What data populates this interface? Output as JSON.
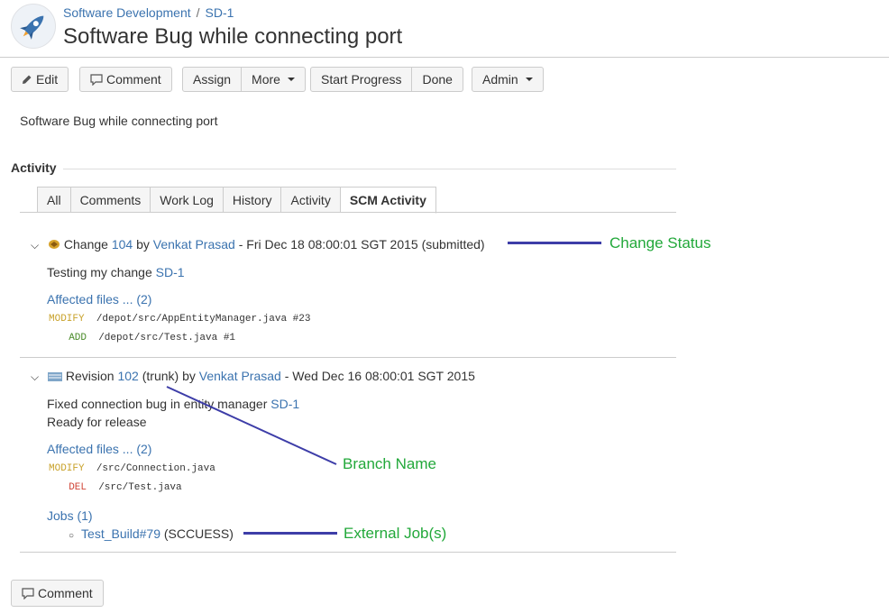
{
  "breadcrumb": {
    "project": "Software Development",
    "separator": "/",
    "issue_key": "SD-1"
  },
  "title": "Software Bug while connecting port",
  "toolbar": {
    "edit": "Edit",
    "comment": "Comment",
    "assign": "Assign",
    "more": "More",
    "start_progress": "Start Progress",
    "done": "Done",
    "admin": "Admin"
  },
  "description": "Software Bug while connecting port",
  "activity": {
    "heading": "Activity",
    "tabs": [
      "All",
      "Comments",
      "Work Log",
      "History",
      "Activity",
      "SCM Activity"
    ],
    "active_tab": "SCM Activity"
  },
  "changes": [
    {
      "kind": "Change",
      "id": "104",
      "by": "by",
      "author": "Venkat Prasad",
      "date": "- Fri Dec 18 08:00:01 SGT 2015",
      "status": "(submitted)",
      "message": "Testing my change",
      "message_link": "SD-1",
      "affected": "Affected files ... (2)",
      "files": [
        {
          "action": "MODIFY",
          "path": "/depot/src/AppEntityManager.java #23"
        },
        {
          "action": "ADD",
          "path": "/depot/src/Test.java #1"
        }
      ]
    },
    {
      "kind": "Revision",
      "id": "102",
      "branch": "(trunk)",
      "by": "by",
      "author": "Venkat Prasad",
      "date": "- Wed Dec 16 08:00:01 SGT 2015",
      "message": "Fixed connection bug in entity manager",
      "message_link": "SD-1",
      "message2": "Ready for release",
      "affected": "Affected files ... (2)",
      "files": [
        {
          "action": "MODIFY",
          "path": "/src/Connection.java"
        },
        {
          "action": "DEL",
          "path": "/src/Test.java"
        }
      ],
      "jobs_label": "Jobs (1)",
      "job_link": "Test_Build#79",
      "job_status": "(SCCUESS)"
    }
  ],
  "annotations": {
    "change_status": "Change Status",
    "branch_name": "Branch Name",
    "external_jobs": "External Job(s)"
  },
  "footer": {
    "comment": "Comment"
  },
  "colors": {
    "annotation_text": "#22a83a",
    "annotation_line": "#3d3da8",
    "link": "#3b73af"
  }
}
